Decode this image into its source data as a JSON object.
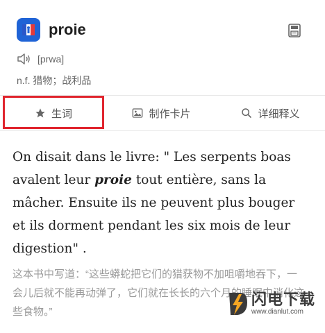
{
  "header": {
    "word": "proie",
    "app_icon": "french-flag-book-icon",
    "save_icon": "save-disk-icon"
  },
  "pronunciation": {
    "icon": "speaker-icon",
    "phonetic": "[prwa]"
  },
  "definition": "n.f. 猎物；战利品",
  "tabs": [
    {
      "label": "生词",
      "icon": "star-icon"
    },
    {
      "label": "制作卡片",
      "icon": "image-card-icon"
    },
    {
      "label": "详细释义",
      "icon": "search-icon"
    }
  ],
  "example": {
    "before": "On disait dans le livre: \" Les serpents boas avalent leur ",
    "highlight": "proie",
    "after": " tout entière, sans la mâcher. Ensuite ils ne peuvent plus bouger et ils dorment pendant les six mois de leur digestion\" ."
  },
  "translation": "这本书中写道：“这些蟒蛇把它们的猎获物不加咀嚼地吞下，一会儿后就不能再动弹了，它们就在长长的六个月的睡眠中消化这些食物。”",
  "watermark": {
    "title": "闪电下载",
    "url": "www.dianlut.com"
  },
  "colors": {
    "highlight_border": "#e0252e",
    "app_icon_bg": "#1f63d6",
    "watermark_orange": "#f5a623"
  }
}
